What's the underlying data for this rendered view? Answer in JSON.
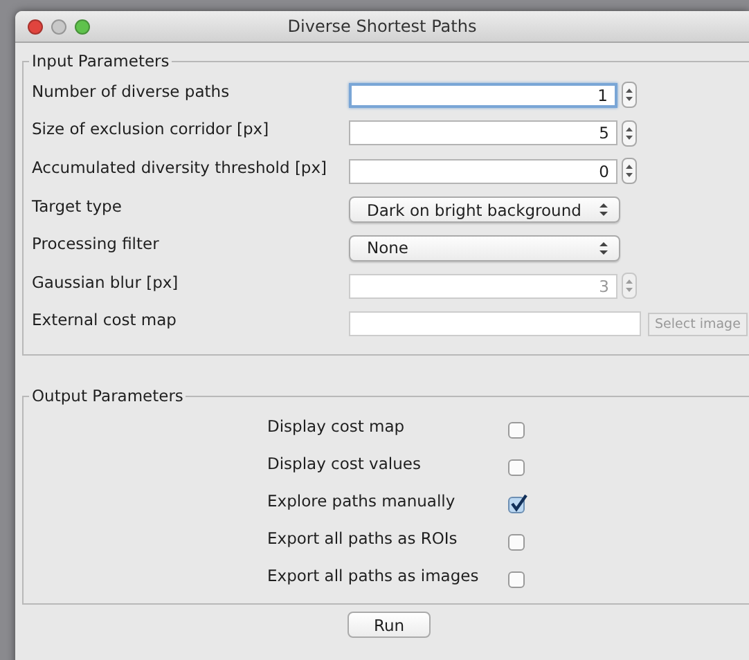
{
  "window": {
    "title": "Diverse Shortest Paths"
  },
  "input_parameters": {
    "title": "Input Parameters",
    "rows": [
      {
        "kind": "spinner",
        "label": "Number of diverse paths",
        "value": "1",
        "focused": true,
        "disabled": false
      },
      {
        "kind": "spinner",
        "label": "Size of exclusion corridor [px]",
        "value": "5",
        "focused": false,
        "disabled": false
      },
      {
        "kind": "spinner",
        "label": "Accumulated diversity threshold [px]",
        "value": "0",
        "focused": false,
        "disabled": false
      },
      {
        "kind": "dropdown",
        "label": "Target type",
        "value": "Dark on bright background"
      },
      {
        "kind": "dropdown",
        "label": "Processing filter",
        "value": "None"
      },
      {
        "kind": "spinner",
        "label": "Gaussian blur [px]",
        "value": "3",
        "focused": false,
        "disabled": true
      },
      {
        "kind": "file",
        "label": "External cost map",
        "button": "Select image",
        "disabled": true
      }
    ]
  },
  "output_parameters": {
    "title": "Output Parameters",
    "options": [
      {
        "label": "Display cost map",
        "checked": false
      },
      {
        "label": "Display cost values",
        "checked": false
      },
      {
        "label": "Explore paths manually",
        "checked": true
      },
      {
        "label": "Export all paths as ROIs",
        "checked": false
      },
      {
        "label": "Export all paths as images",
        "checked": false
      }
    ]
  },
  "buttons": [
    "Run"
  ]
}
